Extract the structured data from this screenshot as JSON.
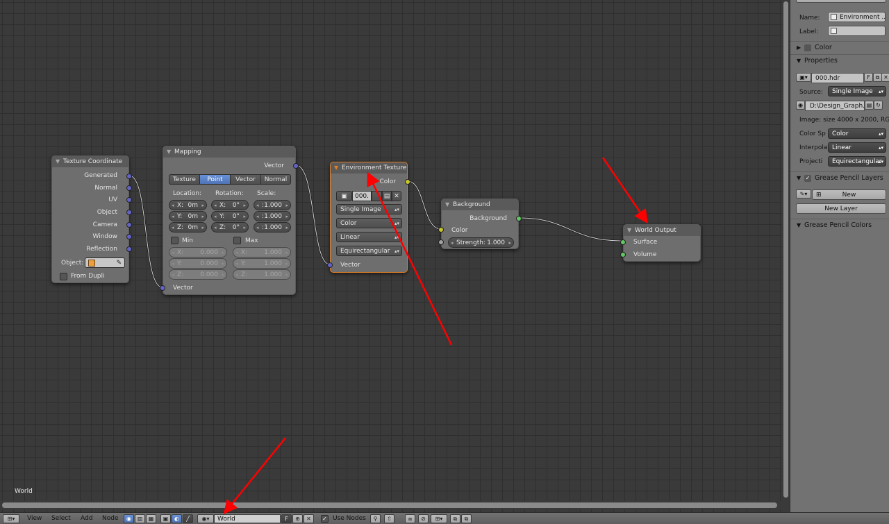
{
  "canvas": {
    "world_label": "World"
  },
  "nodes": {
    "texcoord": {
      "title": "Texture Coordinate",
      "outputs": [
        "Generated",
        "Normal",
        "UV",
        "Object",
        "Camera",
        "Window",
        "Reflection"
      ],
      "object_label": "Object:",
      "from_dupli": "From Dupli"
    },
    "mapping": {
      "title": "Mapping",
      "output": "Vector",
      "modes": [
        "Texture",
        "Point",
        "Vector",
        "Normal"
      ],
      "active_mode": "Point",
      "location_label": "Location:",
      "rotation_label": "Rotation:",
      "scale_label": "Scale:",
      "loc": [
        {
          "axis": "X:",
          "value": "0m"
        },
        {
          "axis": "Y:",
          "value": "0m"
        },
        {
          "axis": "Z:",
          "value": "0m"
        }
      ],
      "rot": [
        {
          "axis": "X:",
          "value": "0°"
        },
        {
          "axis": "Y:",
          "value": "0°"
        },
        {
          "axis": "Z:",
          "value": "0°"
        }
      ],
      "scale": [
        {
          "axis": ":",
          "value": "1.000"
        },
        {
          "axis": ":",
          "value": "1.000"
        },
        {
          "axis": ":",
          "value": "1.000"
        }
      ],
      "min_label": "Min",
      "max_label": "Max",
      "min": [
        {
          "axis": "X:",
          "value": "0.000"
        },
        {
          "axis": "Y:",
          "value": "0.000"
        },
        {
          "axis": "Z:",
          "value": "0.000"
        }
      ],
      "max": [
        {
          "axis": "X:",
          "value": "1.000"
        },
        {
          "axis": "Y:",
          "value": "1.000"
        },
        {
          "axis": "Z:",
          "value": "1.000"
        }
      ],
      "input": "Vector"
    },
    "envtex": {
      "title": "Environment Texture",
      "output": "Color",
      "image_name": "000.",
      "source": "Single Image",
      "color_space": "Color",
      "interpolation": "Linear",
      "projection": "Equirectangular",
      "input": "Vector"
    },
    "background": {
      "title": "Background",
      "output": "Background",
      "input_color": "Color",
      "strength_label": "Strength:",
      "strength_value": "1.000"
    },
    "worldout": {
      "title": "World Output",
      "inputs": [
        "Surface",
        "Volume"
      ]
    }
  },
  "panel": {
    "name_label": "Name:",
    "name_value": "Environment ...",
    "label_label": "Label:",
    "label_value": "",
    "color_section": "Color",
    "properties_section": "Properties",
    "image_name": "000.hdr",
    "fake_user": "F",
    "source_label": "Source:",
    "source_value": "Single Image",
    "filepath": "D:\\Design_Graph...",
    "image_info": "Image: size 4000 x 2000, RG",
    "colorspace_label": "Color Sp",
    "colorspace_value": "Color",
    "interp_label": "Interpola",
    "interp_value": "Linear",
    "proj_label": "Projecti",
    "proj_value": "Equirectangular",
    "gp_layers": "Grease Pencil Layers",
    "new_button": "New",
    "new_layer_button": "New Layer",
    "gp_colors": "Grease Pencil Colors"
  },
  "header": {
    "menus": [
      "View",
      "Select",
      "Add",
      "Node"
    ],
    "world_value": "World",
    "fake_user": "F",
    "use_nodes": "Use Nodes"
  },
  "colors": {
    "canvas_bg": "#3a3a3a",
    "node_body": "#6e6e6e",
    "active_outline": "#e07f28",
    "vector_socket": "#6363c7",
    "color_socket": "#c7c729",
    "shader_socket": "#63c763",
    "annotation_arrow": "#ff0000"
  }
}
